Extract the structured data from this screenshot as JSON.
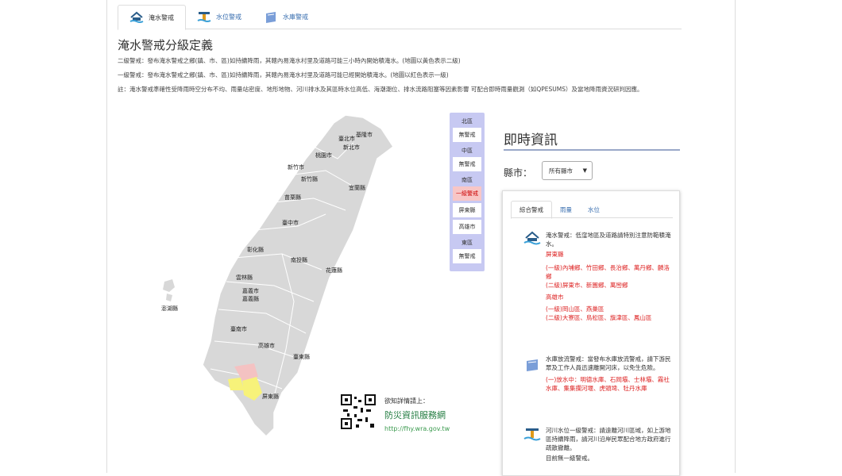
{
  "tabs": [
    {
      "label": "淹水警戒",
      "icon": "flood-icon"
    },
    {
      "label": "水位警戒",
      "icon": "water-level-icon"
    },
    {
      "label": "水庫警戒",
      "icon": "reservoir-icon"
    }
  ],
  "page_title": "淹水警戒分級定義",
  "definitions": [
    "二級警戒：發布淹水警戒之鄉(鎮、市、區)如持續降雨，其轄內易淹水村里及道路可能三小時內開始積淹水。(地圖以黃色表示二級)",
    "一級警戒：發布淹水警戒之鄉(鎮、市、區)如持續降雨，其轄內易淹水村里及道路可能已經開始積淹水。(地圖以紅色表示一級)",
    "註：淹水警戒準確性受降雨時空分布不均、雨量站密度、地形地物、河川排水及其區時水位高低、海潮潮位、排水流路阻塞等因素影響 可配合即時雨量觀測（如QPESUMS）及當地降雨資況研判因應。"
  ],
  "map_labels": {
    "taipei": "臺北市",
    "newtaipei": "新北市",
    "keelung": "基隆市",
    "taoyuan": "桃園市",
    "hsinchucity": "新竹市",
    "hsinchu": "新竹縣",
    "yilan": "宜蘭縣",
    "miaoli": "苗栗縣",
    "taichung": "臺中市",
    "changhua": "彰化縣",
    "nantou": "南投縣",
    "hualien": "花蓮縣",
    "yunlin": "雲林縣",
    "chiayi": "嘉義縣",
    "chiayicity": "嘉義市",
    "penghu": "澎湖縣",
    "tainan": "臺南市",
    "kaohsiung": "高雄市",
    "taitung": "臺東縣",
    "pingtung": "屏東縣"
  },
  "legend": {
    "north": {
      "label": "北區",
      "value": "無警戒"
    },
    "central": {
      "label": "中區",
      "value": "無警戒"
    },
    "south": {
      "label": "南區",
      "value": "一級警戒",
      "items": [
        "屏東縣",
        "高雄市"
      ]
    },
    "east": {
      "label": "東區",
      "value": "無警戒"
    }
  },
  "qr": {
    "prompt": "欲知詳情請上：",
    "site_name": "防災資訊服務網",
    "url": "http://fhy.wra.gov.tw"
  },
  "realtime": {
    "title": "即時資訊",
    "county_label": "縣市：",
    "county_select": "所有縣市",
    "panel_tabs": [
      "綜合警戒",
      "雨量",
      "水位"
    ],
    "flood": {
      "heading": "淹水警戒：低窪地區及道路請特別注意防範積淹水。",
      "county1": "屏東縣",
      "county1_l1": "(一級)內埔鄉、竹田鄉、長治鄉、萬丹鄉、麟洛鄉",
      "county1_l2": "(二級)屏東市、新園鄉、萬巒鄉",
      "county2": "高雄市",
      "county2_l1": "(一級)岡山區、燕巢區",
      "county2_l2": "(二級)大寮區、鳥松區、旗津區、鳳山區"
    },
    "reservoir": {
      "heading": "水庫放流警戒：當發布水庫放流警戒，請下游民眾及工作人員迅速離開河床，以免生危險。",
      "detail": "(一)放水中：明德水庫、石岡壩、士林壩、霧社水庫、集集攔河堰、虎頭埤、牡丹水庫"
    },
    "river": {
      "heading": "河川水位一級警戒：請遠離河川區域，如上游地區持續降雨，請河川沿岸民眾配合地方政府進行疏散撤離。",
      "detail": "目前無一級警戒。"
    }
  },
  "colors": {
    "level1": "#f4c2c2",
    "level2": "#f7f27a",
    "map_fill": "#d8d8d8",
    "accent": "#3a6fb0"
  }
}
